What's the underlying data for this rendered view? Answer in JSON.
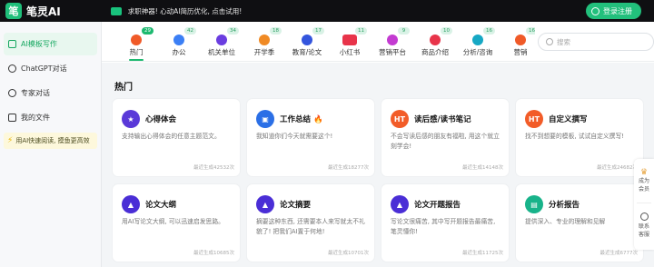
{
  "app": {
    "logo_mark": "笔",
    "name": "笔灵AI"
  },
  "promo": {
    "text": "求职神器! 心动AI简历优化, 点击试用!"
  },
  "header": {
    "login_label": "登录注册"
  },
  "sidebar": {
    "items": [
      {
        "label": "AI模板写作",
        "icon": "template-icon",
        "active": true
      },
      {
        "label": "ChatGPT对话",
        "icon": "chat-icon"
      },
      {
        "label": "专家对话",
        "icon": "expert-icon"
      },
      {
        "label": "我的文件",
        "icon": "file-icon"
      }
    ],
    "promo": "用AI快速阅读, 摸鱼更高效"
  },
  "categories": [
    {
      "label": "热门",
      "count": "29",
      "color": "#f05a28",
      "active": true
    },
    {
      "label": "办公",
      "count": "42",
      "color": "#3b7ff5"
    },
    {
      "label": "机关单位",
      "count": "34",
      "color": "#6a3de0"
    },
    {
      "label": "开学季",
      "count": "18",
      "color": "#f08a24"
    },
    {
      "label": "教育/论文",
      "count": "17",
      "color": "#3355dd"
    },
    {
      "label": "小红书",
      "count": "11",
      "color": "#e8344a"
    },
    {
      "label": "营销平台",
      "count": "9",
      "color": "#c33bd1"
    },
    {
      "label": "商品介绍",
      "count": "10",
      "color": "#e8344a"
    },
    {
      "label": "分析/咨询",
      "count": "16",
      "color": "#16a8c4"
    },
    {
      "label": "营销",
      "count": "16",
      "color": "#f05a28"
    }
  ],
  "search": {
    "placeholder": "搜索"
  },
  "section": {
    "title": "热门"
  },
  "cards": [
    {
      "title": "心得体会",
      "desc": "支持输出心得体会的任意主题范文。",
      "foot": "最近生成42532次",
      "color": "#5a39d8",
      "icon": "star-icon",
      "glyph": "★"
    },
    {
      "title": "工作总结",
      "fire": true,
      "desc": "我知道你们今天就需要这个!",
      "foot": "最近生成18277次",
      "color": "#2b6fe6",
      "icon": "briefcase-icon",
      "glyph": "▣"
    },
    {
      "title": "读后感/读书笔记",
      "desc": "不会写读后感的朋友有福啦, 用这个就立刻学会!",
      "foot": "最近生成14148次",
      "color": "#f25c28",
      "icon": "ht-icon",
      "glyph": "HT"
    },
    {
      "title": "自定义撰写",
      "desc": "找不到想要的模板, 试试自定义撰写!",
      "foot": "最近生成24682次",
      "color": "#f25c28",
      "icon": "ht-icon",
      "glyph": "HT"
    },
    {
      "title": "论文大纲",
      "desc": "用AI写论文大纲, 可以迅速启发思路。",
      "foot": "最近生成10685次",
      "color": "#4a2ed6",
      "icon": "graduation-cap-icon",
      "glyph": "🎓"
    },
    {
      "title": "论文摘要",
      "desc": "摘要这种东西, 还需要本人来写就太不礼貌了! 把我们AI置于何地!",
      "foot": "最近生成10701次",
      "color": "#4a2ed6",
      "icon": "graduation-cap-icon",
      "glyph": "🎓"
    },
    {
      "title": "论文开题报告",
      "desc": "写论文很痛苦, 其中写开题报告最痛苦, 笔灵懂你!",
      "foot": "最近生成11725次",
      "color": "#4a2ed6",
      "icon": "graduation-cap-icon",
      "glyph": "🎓"
    },
    {
      "title": "分析报告",
      "desc": "提供深入、专业的理解和见解",
      "foot": "最近生成6777次",
      "color": "#18b38a",
      "icon": "report-icon",
      "glyph": "▤"
    }
  ],
  "float_panel": {
    "member_label": "成为会员",
    "service_label": "联系客服"
  }
}
